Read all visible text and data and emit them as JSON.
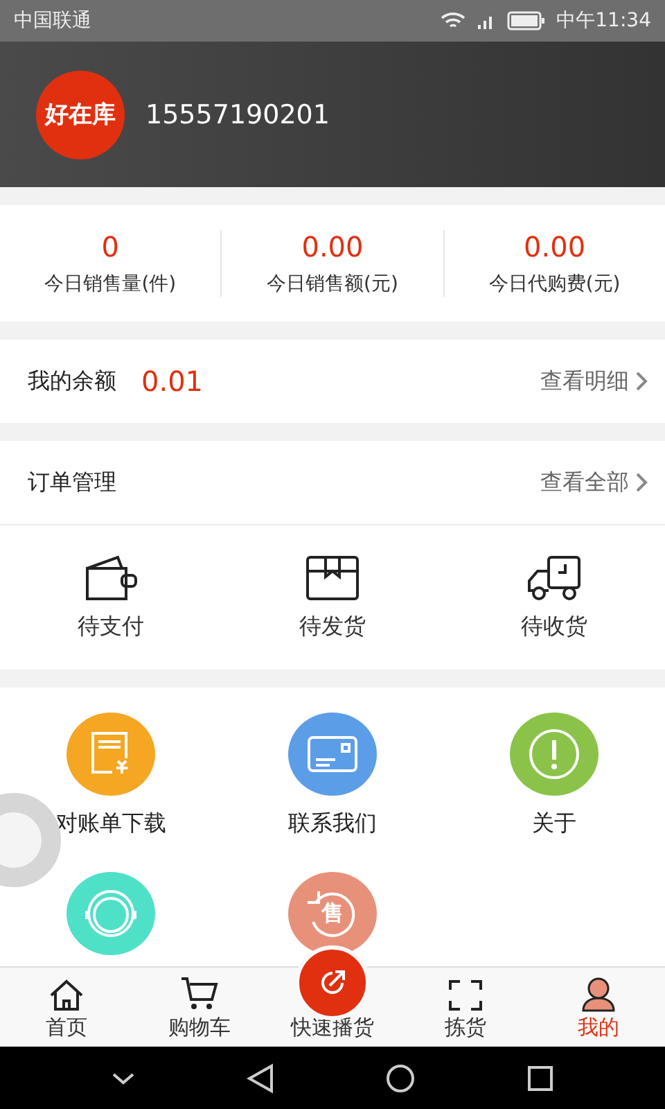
{
  "status_bar": {
    "carrier": "中国联通",
    "time": "中午11:34"
  },
  "profile": {
    "logo": "好在库",
    "phone": "15557190201"
  },
  "stats": [
    {
      "value": "0",
      "label": "今日销售量(件)"
    },
    {
      "value": "0.00",
      "label": "今日销售额(元)"
    },
    {
      "value": "0.00",
      "label": "今日代购费(元)"
    }
  ],
  "balance": {
    "label": "我的余额",
    "amount": "0.01",
    "link": "查看明细"
  },
  "orders": {
    "title": "订单管理",
    "link": "查看全部",
    "items": [
      {
        "kind": "wallet",
        "label": "待支付"
      },
      {
        "kind": "box",
        "label": "待发货"
      },
      {
        "kind": "truck",
        "label": "待收货"
      }
    ]
  },
  "services": [
    {
      "kind": "bill",
      "color": "#f5a623",
      "label": "对账单下载"
    },
    {
      "kind": "card",
      "color": "#5c9de8",
      "label": "联系我们"
    },
    {
      "kind": "info",
      "color": "#8bc34a",
      "label": "关于"
    },
    {
      "kind": "support",
      "color": "#4fe0c8"
    },
    {
      "kind": "aftersale",
      "color": "#e8917a",
      "glyph": "售"
    }
  ],
  "tabs": [
    {
      "kind": "home",
      "label": "首页",
      "selected": false
    },
    {
      "kind": "cart",
      "label": "购物车",
      "selected": false
    },
    {
      "kind": "fab",
      "label": "快速播货",
      "selected": false
    },
    {
      "kind": "scan",
      "label": "拣货",
      "selected": false
    },
    {
      "kind": "user",
      "label": "我的",
      "selected": true
    }
  ]
}
